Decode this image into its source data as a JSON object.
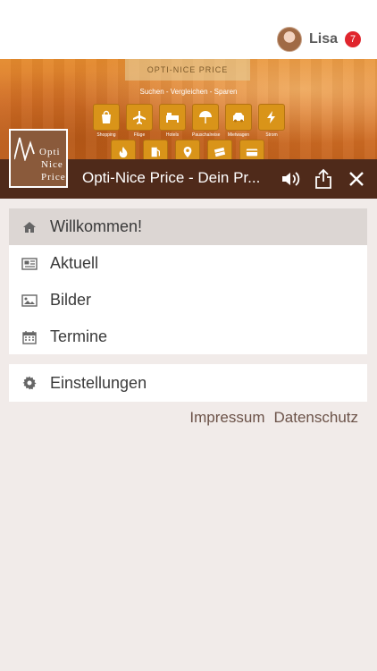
{
  "user": {
    "name": "Lisa",
    "notifications": "7"
  },
  "banner": {
    "logo_text": "OPTI-NICE PRICE",
    "tagline": "Suchen - Vergleichen - Sparen",
    "categories": [
      {
        "label": "Shopping",
        "icon": "shopping-bag-icon"
      },
      {
        "label": "Flüge",
        "icon": "plane-icon"
      },
      {
        "label": "Hotels",
        "icon": "bed-icon"
      },
      {
        "label": "Pauschalreise",
        "icon": "umbrella-icon"
      },
      {
        "label": "Mietwagen",
        "icon": "car-icon"
      },
      {
        "label": "Strom",
        "icon": "lightning-icon"
      }
    ]
  },
  "app": {
    "title": "Opti-Nice Price - Dein Pr...",
    "logo_lines": [
      "Opti",
      "Nice",
      "Price"
    ]
  },
  "menu": {
    "items": [
      {
        "label": "Willkommen!",
        "icon": "home-icon",
        "active": true
      },
      {
        "label": "Aktuell",
        "icon": "newspaper-icon",
        "active": false
      },
      {
        "label": "Bilder",
        "icon": "image-icon",
        "active": false
      },
      {
        "label": "Termine",
        "icon": "calendar-icon",
        "active": false
      }
    ],
    "settings": {
      "label": "Einstellungen",
      "icon": "gear-icon"
    }
  },
  "footer": {
    "impressum": "Impressum",
    "datenschutz": "Datenschutz"
  },
  "colors": {
    "titlebar": "#4f2a1a",
    "badge": "#e0252d",
    "banner": "#d9742a",
    "active_item": "#dcd6d3"
  }
}
